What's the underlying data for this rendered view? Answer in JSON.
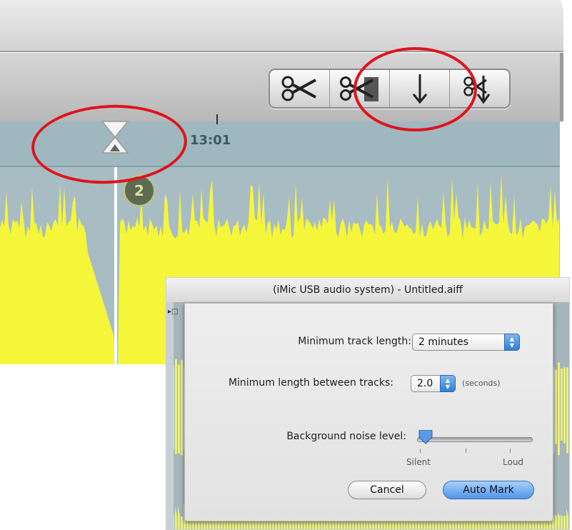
{
  "toolbar": {
    "tools": [
      {
        "icon": "scissors-icon"
      },
      {
        "icon": "scissors-trim-icon"
      },
      {
        "icon": "down-arrow-icon"
      },
      {
        "icon": "scissors-arrow-icon"
      }
    ]
  },
  "timeline": {
    "time_label": "13:01",
    "marker_number": "2"
  },
  "dialog": {
    "title": "(iMic USB audio system) - Untitled.aiff",
    "min_track_length_label": "Minimum track length:",
    "min_track_length_value": "2 minutes",
    "min_between_label": "Minimum length between tracks:",
    "min_between_value": "2.0",
    "seconds_unit": "(seconds)",
    "noise_label": "Background noise level:",
    "noise_level": 0.05,
    "silent_label": "Silent",
    "loud_label": "Loud",
    "cancel_label": "Cancel",
    "automark_label": "Auto Mark"
  },
  "colors": {
    "waveform": "#f5f53a",
    "annotation": "#e0121b",
    "accent": "#3b8ae6"
  }
}
